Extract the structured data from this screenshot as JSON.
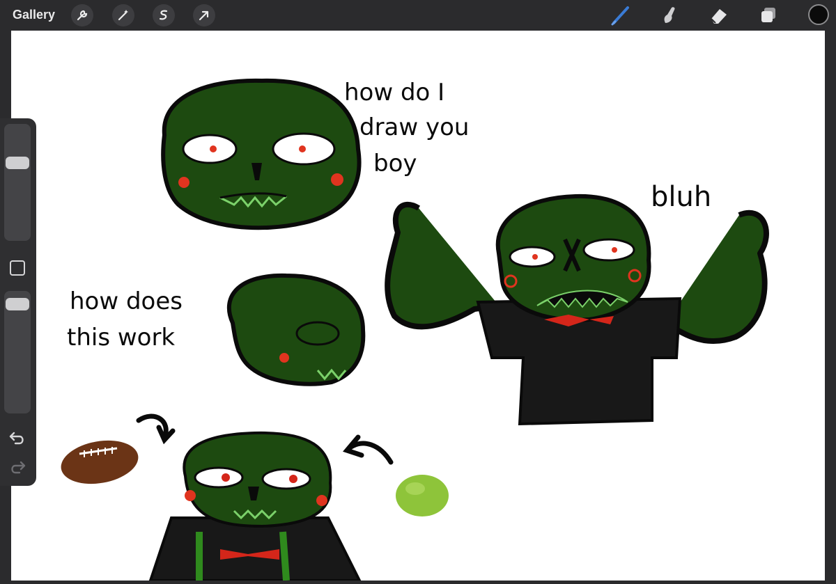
{
  "toolbar": {
    "gallery_label": "Gallery",
    "left_tools": [
      "wrench-icon",
      "magic-wand-icon",
      "selection-icon",
      "transform-arrow-icon"
    ],
    "right_tools": [
      "brush-icon",
      "smudge-icon",
      "eraser-icon",
      "layers-icon"
    ],
    "active_tool": "brush-icon",
    "active_tool_color": "#3a7bd5",
    "current_color": "#0b0b0b"
  },
  "sidebar": {
    "brush_size_level": 0.3,
    "opacity_level": 0.05,
    "icons": [
      "modify-square-icon",
      "undo-icon",
      "redo-icon"
    ]
  },
  "canvas": {
    "notes": {
      "note_1_line_1": "how do I",
      "note_1_line_2": "draw you",
      "note_1_line_3": "boy",
      "note_2": "bluh",
      "note_3_line_1": "how does",
      "note_3_line_2": "this work"
    },
    "colors": {
      "skin": "#1d4a10",
      "outline": "#0a0a0a",
      "shirt": "#181818",
      "bowtie": "#d4261a",
      "cheek": "#e0341f",
      "suspender": "#2f8a1d",
      "football": "#6b3416",
      "lime": "#8ec43a"
    }
  }
}
